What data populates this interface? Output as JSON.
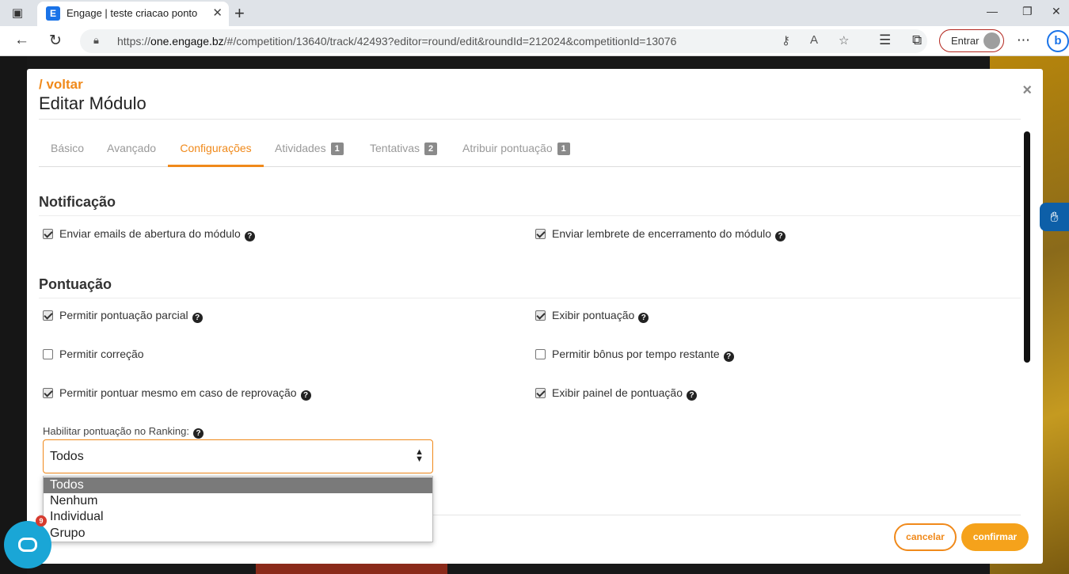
{
  "browser": {
    "tab_title": "Engage | teste criacao ponto",
    "tab_favicon": "E",
    "new_tab": "+",
    "url_scheme": "https://",
    "url_host": "one.engage.bz",
    "url_path": "/#/competition/13640/track/42493?editor=round/edit&roundId=212024&competitionId=13076",
    "signin_label": "Entrar",
    "bing_label": "b",
    "icons": {
      "sidebar": "tab-sidebar-icon",
      "back": "back-arrow-icon",
      "reload": "reload-icon",
      "lock": "lock-icon",
      "key": "key-icon",
      "read_aloud": "read-aloud-icon",
      "favorite_add": "add-favorite-icon",
      "favorites": "favorites-icon",
      "collections": "collections-icon",
      "more": "more-icon"
    }
  },
  "modal": {
    "back_link": "/ voltar",
    "title": "Editar Módulo",
    "close": "×",
    "tabs": [
      {
        "label": "Básico",
        "badge": ""
      },
      {
        "label": "Avançado",
        "badge": ""
      },
      {
        "label": "Configurações",
        "badge": ""
      },
      {
        "label": "Atividades",
        "badge": "1"
      },
      {
        "label": "Tentativas",
        "badge": "2"
      },
      {
        "label": "Atribuir pontuação",
        "badge": "1"
      }
    ],
    "active_tab": "Configurações",
    "sections": {
      "notificacao": {
        "title": "Notificação",
        "options": [
          {
            "label": "Enviar emails de abertura do módulo",
            "checked": true
          },
          {
            "label": "Enviar lembrete de encerramento do módulo",
            "checked": true
          }
        ]
      },
      "pontuacao": {
        "title": "Pontuação",
        "options": [
          {
            "label": "Permitir pontuação parcial",
            "checked": true
          },
          {
            "label": "Exibir pontuação",
            "checked": true
          },
          {
            "label": "Permitir correção",
            "checked": false
          },
          {
            "label": "Permitir bônus por tempo restante",
            "checked": false
          },
          {
            "label": "Permitir pontuar mesmo em caso de reprovação",
            "checked": true
          },
          {
            "label": "Exibir painel de pontuação",
            "checked": true
          }
        ]
      }
    },
    "ranking": {
      "label": "Habilitar pontuação no Ranking:",
      "selected": "Todos",
      "options": [
        "Todos",
        "Nenhum",
        "Individual",
        "Grupo"
      ]
    },
    "footer": {
      "cancel_label": "cancelar",
      "confirm_label": "confirmar"
    },
    "help_glyph": "?"
  },
  "widgets": {
    "chat_badge": "9",
    "accessibility_icon": "hand-sign-icon"
  },
  "colors": {
    "accent": "#f0891a",
    "confirm_bg": "#f5a21b",
    "chat_bg": "#1aa6d6",
    "accessibility_bg": "#0d5fa8"
  }
}
